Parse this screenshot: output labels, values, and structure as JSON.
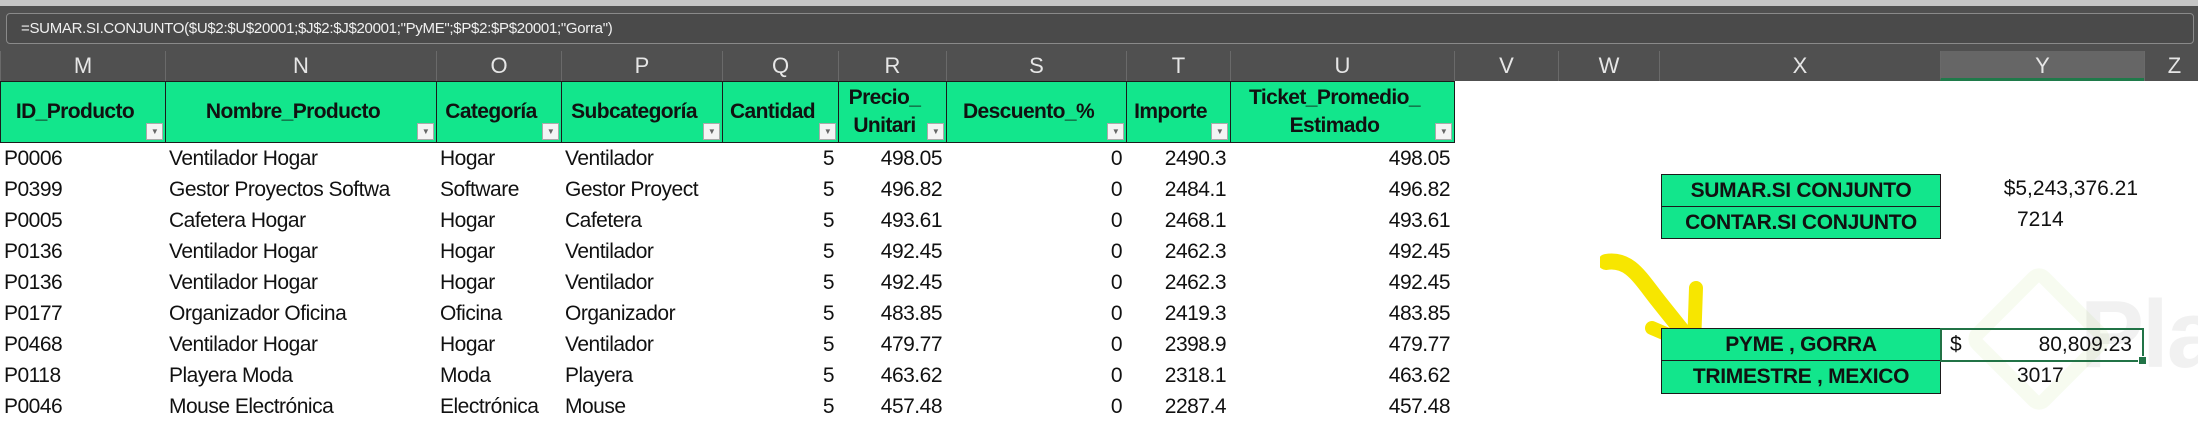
{
  "formula_bar": {
    "formula": "=SUMAR.SI.CONJUNTO($U$2:$U$20001;$J$2:$J$20001;\"PyME\";$P$2:$P$20001;\"Gorra\")"
  },
  "columns": [
    "M",
    "N",
    "O",
    "P",
    "Q",
    "R",
    "S",
    "T",
    "U",
    "V",
    "W",
    "X",
    "Y",
    "Z"
  ],
  "selected_column": "Y",
  "table": {
    "headers": [
      {
        "col": "M",
        "label": "ID_Producto"
      },
      {
        "col": "N",
        "label": "Nombre_Producto"
      },
      {
        "col": "O",
        "label": "Categoría"
      },
      {
        "col": "P",
        "label": "Subcategoría"
      },
      {
        "col": "Q",
        "label": "Cantidad"
      },
      {
        "col": "R",
        "label": "Precio_ Unitari"
      },
      {
        "col": "S",
        "label": "Descuento_%"
      },
      {
        "col": "T",
        "label": "Importe"
      },
      {
        "col": "U",
        "label": "Ticket_Promedio_ Estimado"
      }
    ],
    "rows": [
      [
        "P0006",
        "Ventilador Hogar",
        "Hogar",
        "Ventilador",
        "5",
        "498.05",
        "0",
        "2490.3",
        "498.05"
      ],
      [
        "P0399",
        "Gestor Proyectos Softwa",
        "Software",
        "Gestor Proyect",
        "5",
        "496.82",
        "0",
        "2484.1",
        "496.82"
      ],
      [
        "P0005",
        "Cafetera Hogar",
        "Hogar",
        "Cafetera",
        "5",
        "493.61",
        "0",
        "2468.1",
        "493.61"
      ],
      [
        "P0136",
        "Ventilador Hogar",
        "Hogar",
        "Ventilador",
        "5",
        "492.45",
        "0",
        "2462.3",
        "492.45"
      ],
      [
        "P0136",
        "Ventilador Hogar",
        "Hogar",
        "Ventilador",
        "5",
        "492.45",
        "0",
        "2462.3",
        "492.45"
      ],
      [
        "P0177",
        "Organizador Oficina",
        "Oficina",
        "Organizador",
        "5",
        "483.85",
        "0",
        "2419.3",
        "483.85"
      ],
      [
        "P0468",
        "Ventilador Hogar",
        "Hogar",
        "Ventilador",
        "5",
        "479.77",
        "0",
        "2398.9",
        "479.77"
      ],
      [
        "P0118",
        "Playera Moda",
        "Moda",
        "Playera",
        "5",
        "463.62",
        "0",
        "2318.1",
        "463.62"
      ],
      [
        "P0046",
        "Mouse Electrónica",
        "Electrónica",
        "Mouse",
        "5",
        "457.48",
        "0",
        "2287.4",
        "457.48"
      ]
    ]
  },
  "summary": {
    "sumar_label": "SUMAR.SI CONJUNTO",
    "sumar_value": "$5,243,376.21",
    "contar_label": "CONTAR.SI CONJUNTO",
    "contar_value": "7214",
    "pyme_label": "PYME , GORRA",
    "pyme_currency": "$",
    "pyme_value": "80,809.23",
    "trimestre_label": "TRIMESTRE , MEXICO",
    "trimestre_value": "3017"
  },
  "watermark": "Platzi",
  "colors": {
    "header_green": "#12e68c",
    "arrow_yellow": "#f7e600",
    "selection": "#217346"
  }
}
